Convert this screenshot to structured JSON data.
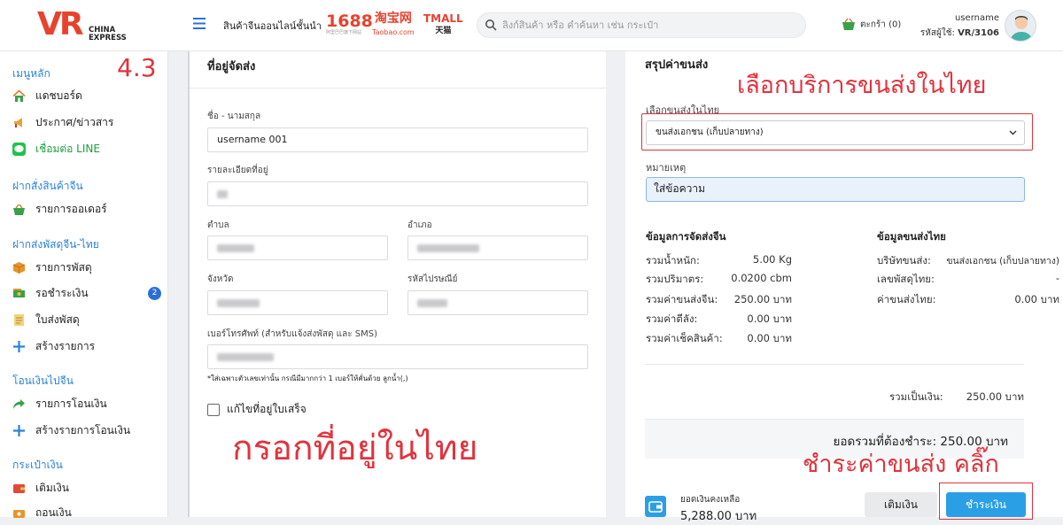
{
  "header": {
    "logo_text": "VR",
    "logo_sub1": "CHINA",
    "logo_sub2": "EXPRESS",
    "slogan": "สินค้าจีนออนไลน์ชั้นนำ",
    "brand_1688": "1688",
    "brand_1688_sub": "阿里巴巴旗下网站",
    "brand_taobao": "淘宝网",
    "brand_taobao_sub": "Taobao.com",
    "brand_tmall": "TMALL",
    "brand_tmall_sub": "天猫",
    "search_placeholder": "ลิงก์สินค้า หรือ คำค้นหา เช่น กระเป๋า",
    "cart_label": "ตะกร้า (0)",
    "username": "username",
    "user_id_label": "รหัสผู้ใช้:",
    "user_id": "VR/3106"
  },
  "sidebar": {
    "version": "4.3",
    "sections": [
      {
        "title": "เมนูหลัก",
        "items": [
          {
            "label": "แดชบอร์ด",
            "icon": "home-icon"
          },
          {
            "label": "ประกาศ/ข่าวสาร",
            "icon": "megaphone-icon"
          },
          {
            "label": "เชื่อมต่อ LINE",
            "icon": "line-icon"
          }
        ]
      },
      {
        "title": "ฝากสั่งสินค้าจีน",
        "items": [
          {
            "label": "รายการออเดอร์",
            "icon": "basket-icon"
          }
        ]
      },
      {
        "title": "ฝากส่งพัสดุจีน-ไทย",
        "items": [
          {
            "label": "รายการพัสดุ",
            "icon": "box-icon"
          },
          {
            "label": "รอชำระเงิน",
            "icon": "money-icon",
            "badge": "2"
          },
          {
            "label": "ใบส่งพัสดุ",
            "icon": "document-icon"
          },
          {
            "label": "สร้างรายการ",
            "icon": "plus-icon"
          }
        ]
      },
      {
        "title": "โอนเงินไปจีน",
        "items": [
          {
            "label": "รายการโอนเงิน",
            "icon": "share-arrow-icon"
          },
          {
            "label": "สร้างรายการโอนเงิน",
            "icon": "plus-icon"
          }
        ]
      },
      {
        "title": "กระเป๋าเงิน",
        "items": [
          {
            "label": "เติมเงิน",
            "icon": "wallet-icon"
          },
          {
            "label": "ถอนเงิน",
            "icon": "withdraw-icon"
          }
        ]
      }
    ]
  },
  "address": {
    "title": "ที่อยู่จัดส่ง",
    "name_label": "ชื่อ - นามสกุล",
    "name_value": "username 001",
    "detail_label": "รายละเอียดที่อยู่",
    "subdistrict_label": "ตำบล",
    "district_label": "อำเภอ",
    "province_label": "จังหวัด",
    "postcode_label": "รหัสไปรษณีย์",
    "phone_label": "เบอร์โทรศัพท์ (สำหรับแจ้งส่งพัสดุ และ SMS)",
    "phone_hint": "*ใส่เฉพาะตัวเลขเท่านั้น กรณีมีมากกว่า 1 เบอร์ให้คั่นด้วย ลูกน้ำ(,)",
    "edit_checkbox_label": "แก้ไขที่อยู่ใบเสร็จ"
  },
  "summary": {
    "title": "สรุปค่าขนส่ง",
    "thai_shipping_label": "เลือกขนส่งในไทย",
    "thai_shipping_selected": "ขนส่งเอกชน (เก็บปลายทาง)",
    "note_label": "หมายเหตุ",
    "note_value": "ใส่ข้อความ",
    "china_title": "ข้อมูลการจัดส่งจีน",
    "china_rows": [
      {
        "label": "รวมน้ำหนัก:",
        "value": "5.00 Kg"
      },
      {
        "label": "รวมปริมาตร:",
        "value": "0.0200 cbm"
      },
      {
        "label": "รวมค่าขนส่งจีน:",
        "value": "250.00 บาท"
      },
      {
        "label": "รวมค่าตีลัง:",
        "value": "0.00 บาท"
      },
      {
        "label": "รวมค่าเช็คสินค้า:",
        "value": "0.00 บาท"
      }
    ],
    "thai_title": "ข้อมูลขนส่งไทย",
    "thai_rows": [
      {
        "label": "บริษัทขนส่ง:",
        "value": "ขนส่งเอกชน (เก็บปลายทาง)"
      },
      {
        "label": "เลขพัสดุไทย:",
        "value": "-"
      },
      {
        "label": "ค่าขนส่งไทย:",
        "value": "0.00 บาท"
      }
    ],
    "total_label": "รวมเป็นเงิน:",
    "total_value": "250.00 บาท",
    "grand_total": "ยอดรวมที่ต้องชำระ: 250.00 บาท",
    "balance_label": "ยอดเงินคงเหลือ",
    "balance_value": "5,288.00 บาท",
    "topup_button": "เติมเงิน",
    "pay_button": "ชำระเงิน"
  },
  "annotations": {
    "select_thai_shipping": "เลือกบริการขนส่งในไทย",
    "fill_address": "กรอกที่อยู่ในไทย",
    "click_pay": "ชำระค่าขนส่ง คลิ๊ก"
  },
  "colors": {
    "accent": "#2b9fe6",
    "annotation_red": "#e0333d",
    "sidebar_section": "#2b83d6"
  }
}
